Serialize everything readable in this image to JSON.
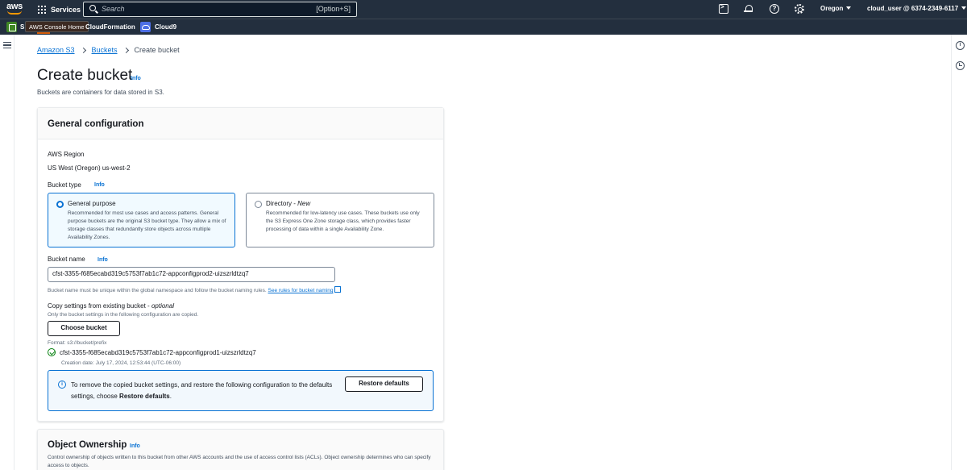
{
  "topnav": {
    "logo_text": "aws",
    "services_label": "Services",
    "search_placeholder": "Search",
    "search_shortcut": "[Option+S]",
    "region": "Oregon",
    "account": "cloud_user @ 6374-2349-6117"
  },
  "favorites": {
    "s3_letter": "S",
    "tooltip": "AWS Console Home",
    "cloudformation": "CloudFormation",
    "cloud9": "Cloud9"
  },
  "breadcrumb": {
    "items": [
      "Amazon S3",
      "Buckets"
    ],
    "current": "Create bucket"
  },
  "page": {
    "title": "Create bucket",
    "info": "Info",
    "description": "Buckets are containers for data stored in S3."
  },
  "general_config": {
    "title": "General configuration",
    "region_label": "AWS Region",
    "region_value": "US West (Oregon) us-west-2",
    "bucket_type_label": "Bucket type",
    "bucket_type_info": "Info",
    "options": [
      {
        "title": "General purpose",
        "desc": "Recommended for most use cases and access patterns. General purpose buckets are the original S3 bucket type. They allow a mix of storage classes that redundantly store objects across multiple Availability Zones.",
        "selected": true
      },
      {
        "title": "Directory - ",
        "title_em": "New",
        "desc": "Recommended for low-latency use cases. These buckets use only the S3 Express One Zone storage class, which provides faster processing of data within a single Availability Zone.",
        "selected": false
      }
    ],
    "bucket_name_label": "Bucket name",
    "bucket_name_info": "Info",
    "bucket_name_value": "cfst-3355-f685ecabd319c5753f7ab1c72-appconfigprod2-uizszrldtzq7",
    "bucket_name_hint": "Bucket name must be unique within the global namespace and follow the bucket naming rules.",
    "bucket_name_link": "See rules for bucket naming",
    "copy_label": "Copy settings from existing bucket - ",
    "copy_label_em": "optional",
    "copy_hint": "Only the bucket settings in the following configuration are copied.",
    "choose_bucket": "Choose bucket",
    "format_hint": "Format: s3://bucket/prefix",
    "selected_bucket": "cfst-3355-f685ecabd319c5753f7ab1c72-appconfigprod1-uizszrldtzq7",
    "creation_date": "Creation date: July 17, 2024, 12:53:44 (UTC-06:00)",
    "alert_text": "To remove the copied bucket settings, and restore the following configuration to the defaults settings, choose ",
    "alert_bold": "Restore defaults",
    "alert_end": ".",
    "restore_button": "Restore defaults"
  },
  "object_ownership": {
    "title": "Object Ownership",
    "info": "Info",
    "desc": "Control ownership of objects written to this bucket from other AWS accounts and the use of access control lists (ACLs). Object ownership determines who can specify access to objects."
  },
  "colors": {
    "nav_bg": "#232f3e",
    "accent": "#0972d3",
    "success": "#037f0c"
  }
}
